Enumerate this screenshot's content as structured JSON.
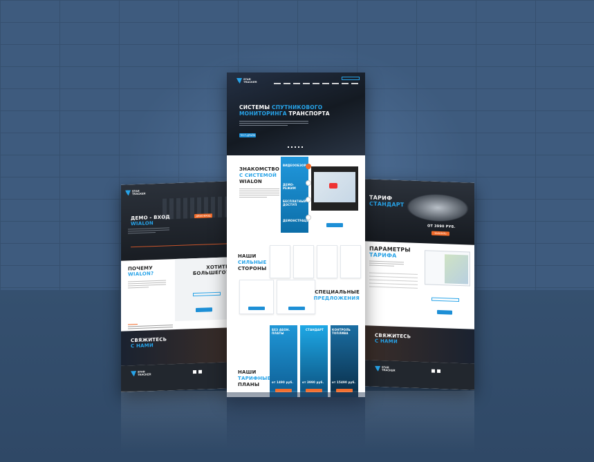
{
  "center": {
    "logo": [
      "STAR",
      "TRACKER"
    ],
    "hero_title_1": "СИСТЕМЫ",
    "hero_title_2": "СПУТНИКОВОГО",
    "hero_title_3": "МОНИТОРИНГА",
    "hero_title_4": "ТРАНСПОРТА",
    "hero_button": "ТЕСТ-ДРАЙВ",
    "intro_1": "ЗНАКОМСТВО",
    "intro_2": "С СИСТЕМОЙ",
    "intro_3": "WIALON",
    "tabs": [
      "ВИДЕООБЗОР",
      "ДЕМО-РЕЖИМ",
      "БЕСПЛАТНЫЙ ДОСТУП",
      "ДЕМОНСТРАЦИЯ"
    ],
    "strengths_1": "НАШИ",
    "strengths_2": "СИЛЬНЫЕ",
    "strengths_3": "СТОРОНЫ",
    "special_1": "СПЕЦИАЛЬНЫЕ",
    "special_2": "ПРЕДЛОЖЕНИЯ",
    "plans_1": "НАШИ",
    "plans_2": "ТАРИФНЫЕ",
    "plans_3": "ПЛАНЫ",
    "plan_titles": [
      "БЕЗ АБОН. ПЛАТЫ",
      "СТАНДАРТ",
      "КОНТРОЛЬ ТОПЛИВА"
    ],
    "plan_prices": [
      "от 1490 руб.",
      "от 3990 руб.",
      "от 15490 руб."
    ]
  },
  "left": {
    "hero_title_1": "ДЕМО - ВХОД",
    "hero_title_2": "WIALON",
    "hero_button": "ДЕМО-ВХОД",
    "why_1": "ПОЧЕМУ",
    "why_2": "WIALON?",
    "want_1": "ХОТИТЕ",
    "want_2": "БОЛЬШЕГО?",
    "contact_1": "СВЯЖИТЕСЬ",
    "contact_2": "С НАМИ"
  },
  "right": {
    "hero_title_1": "ТАРИФ",
    "hero_title_2": "СТАНДАРТ",
    "price": "ОТ 3990 РУБ.",
    "button": "ЗАКАЗАТЬ",
    "params_1": "ПАРАМЕТРЫ",
    "params_2": "ТАРИФА",
    "contact_1": "СВЯЖИТЕСЬ",
    "contact_2": "С НАМИ"
  },
  "colors": {
    "accent_blue": "#27a3e8",
    "accent_orange": "#f26b2a",
    "background": "#3e5b7e"
  }
}
